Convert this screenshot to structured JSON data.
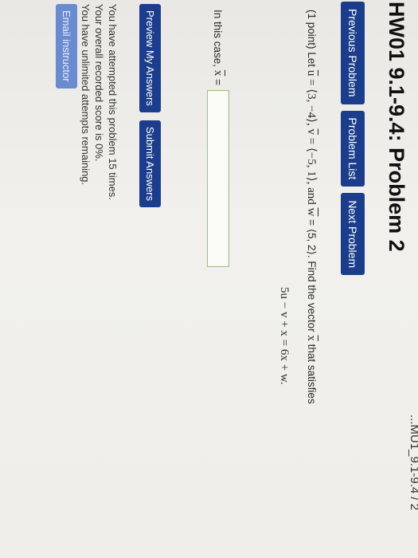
{
  "header": {
    "breadcrumb_fragment": "...MU1_9.1-9.4 / 2",
    "title": "HW01 9.1-9.4: Problem 2"
  },
  "nav": {
    "previous": "Previous Problem",
    "list": "Problem List",
    "next": "Next Problem"
  },
  "problem": {
    "points": "(1 point) Let",
    "u_label": "u",
    "u_value": "= ⟨3, −4⟩,",
    "v_label": "v",
    "v_value": "= ⟨−5, 1⟩, and",
    "w_label": "w",
    "w_value": "= ⟨5, 2⟩. Find the vector",
    "x_label": "x",
    "tail": "that satisfies",
    "equation": "5u − v + x = 6x + w."
  },
  "answer": {
    "prompt": "In this case,",
    "x_label": "x",
    "equals": "=",
    "value": ""
  },
  "actions": {
    "preview": "Preview My Answers",
    "submit": "Submit Answers"
  },
  "status": {
    "attempts": "You have attempted this problem 15 times.",
    "score": "Your overall recorded score is 0%.",
    "remaining": "You have unlimited attempts remaining."
  },
  "footer": {
    "email": "Email instructor"
  }
}
